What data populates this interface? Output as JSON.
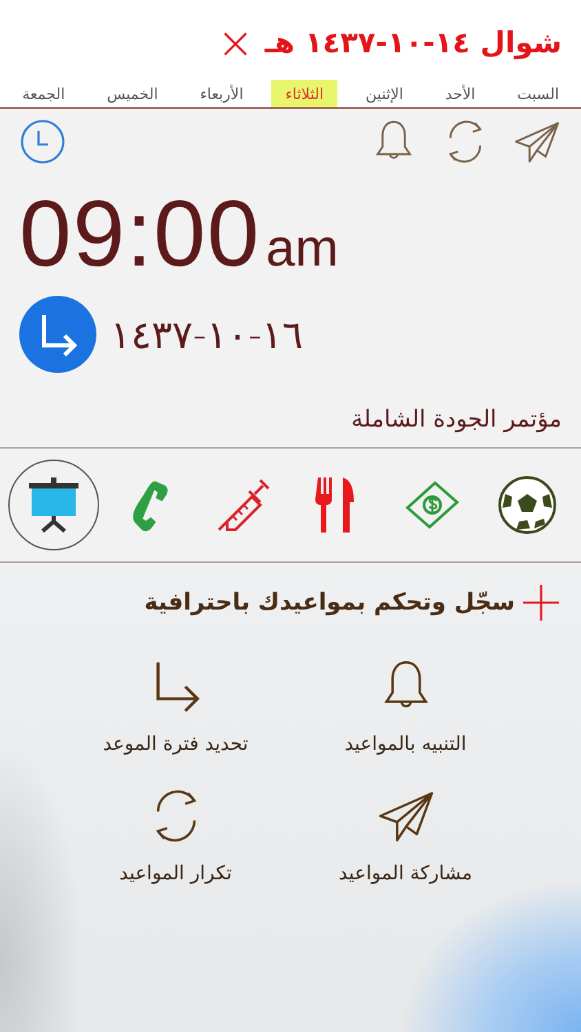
{
  "header": {
    "title": "شوال ١٤-١٠-١٤٣٧ هـ",
    "close": "×"
  },
  "tabs": [
    {
      "label": "السبت",
      "selected": false
    },
    {
      "label": "الأحد",
      "selected": false
    },
    {
      "label": "الإثنين",
      "selected": false
    },
    {
      "label": "الثلاثاء",
      "selected": true
    },
    {
      "label": "الأربعاء",
      "selected": false
    },
    {
      "label": "الخميس",
      "selected": false
    },
    {
      "label": "الجمعة",
      "selected": false
    }
  ],
  "time": {
    "value": "09:00",
    "period": "am"
  },
  "end_date": "١٦-١٠-١٤٣٧",
  "event_title": "مؤتمر الجودة الشاملة",
  "categories": [
    {
      "kind": "football",
      "selected": false
    },
    {
      "kind": "money",
      "selected": false
    },
    {
      "kind": "food",
      "selected": false
    },
    {
      "kind": "medicine",
      "selected": false
    },
    {
      "kind": "phone",
      "selected": false
    },
    {
      "kind": "presentation",
      "selected": true
    }
  ],
  "promo": {
    "heading": "سجّل وتحكم بمواعيدك باحترافية",
    "features": [
      {
        "kind": "bell",
        "label": "التنبيه بالمواعيد"
      },
      {
        "kind": "period",
        "label": "تحديد فترة الموعد"
      },
      {
        "kind": "share",
        "label": "مشاركة المواعيد"
      },
      {
        "kind": "repeat",
        "label": "تكرار المواعيد"
      }
    ]
  }
}
